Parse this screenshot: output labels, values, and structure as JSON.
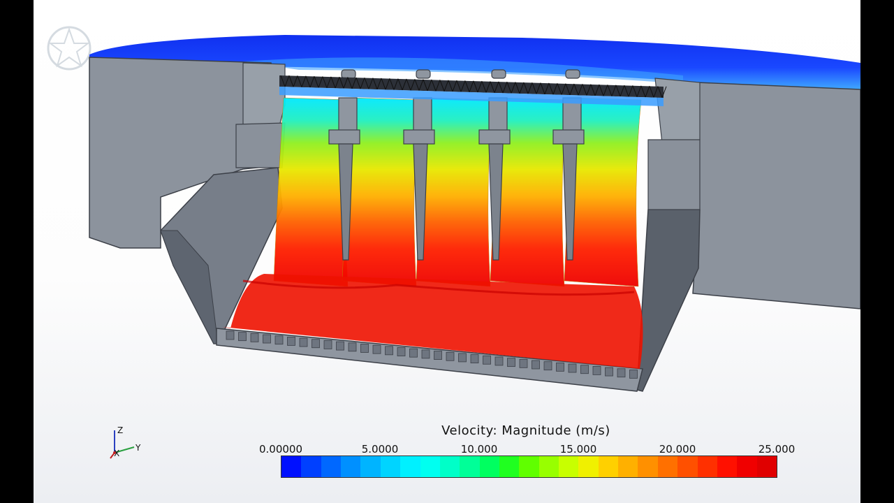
{
  "legend": {
    "title": "Velocity: Magnitude (m/s)",
    "ticks": [
      "0.00000",
      "5.0000",
      "10.000",
      "15.000",
      "20.000",
      "25.000"
    ],
    "range": [
      0,
      25
    ],
    "colors": [
      "#0010ff",
      "#0040ff",
      "#0068ff",
      "#0090ff",
      "#00b4ff",
      "#00d4ff",
      "#00f0ff",
      "#00fff0",
      "#00ffc8",
      "#00ff98",
      "#00ff60",
      "#20ff20",
      "#60ff00",
      "#98ff00",
      "#c8ff00",
      "#f0f000",
      "#ffd000",
      "#ffb000",
      "#ff9000",
      "#ff7000",
      "#ff5000",
      "#ff3000",
      "#ff1000",
      "#f00000",
      "#e00000"
    ]
  },
  "axes": {
    "z": "Z",
    "x": "X",
    "y": "Y"
  },
  "colors": {
    "structure": "#8c939d",
    "structure_dark": "#5f6570",
    "water_surface": "#1432f0"
  }
}
